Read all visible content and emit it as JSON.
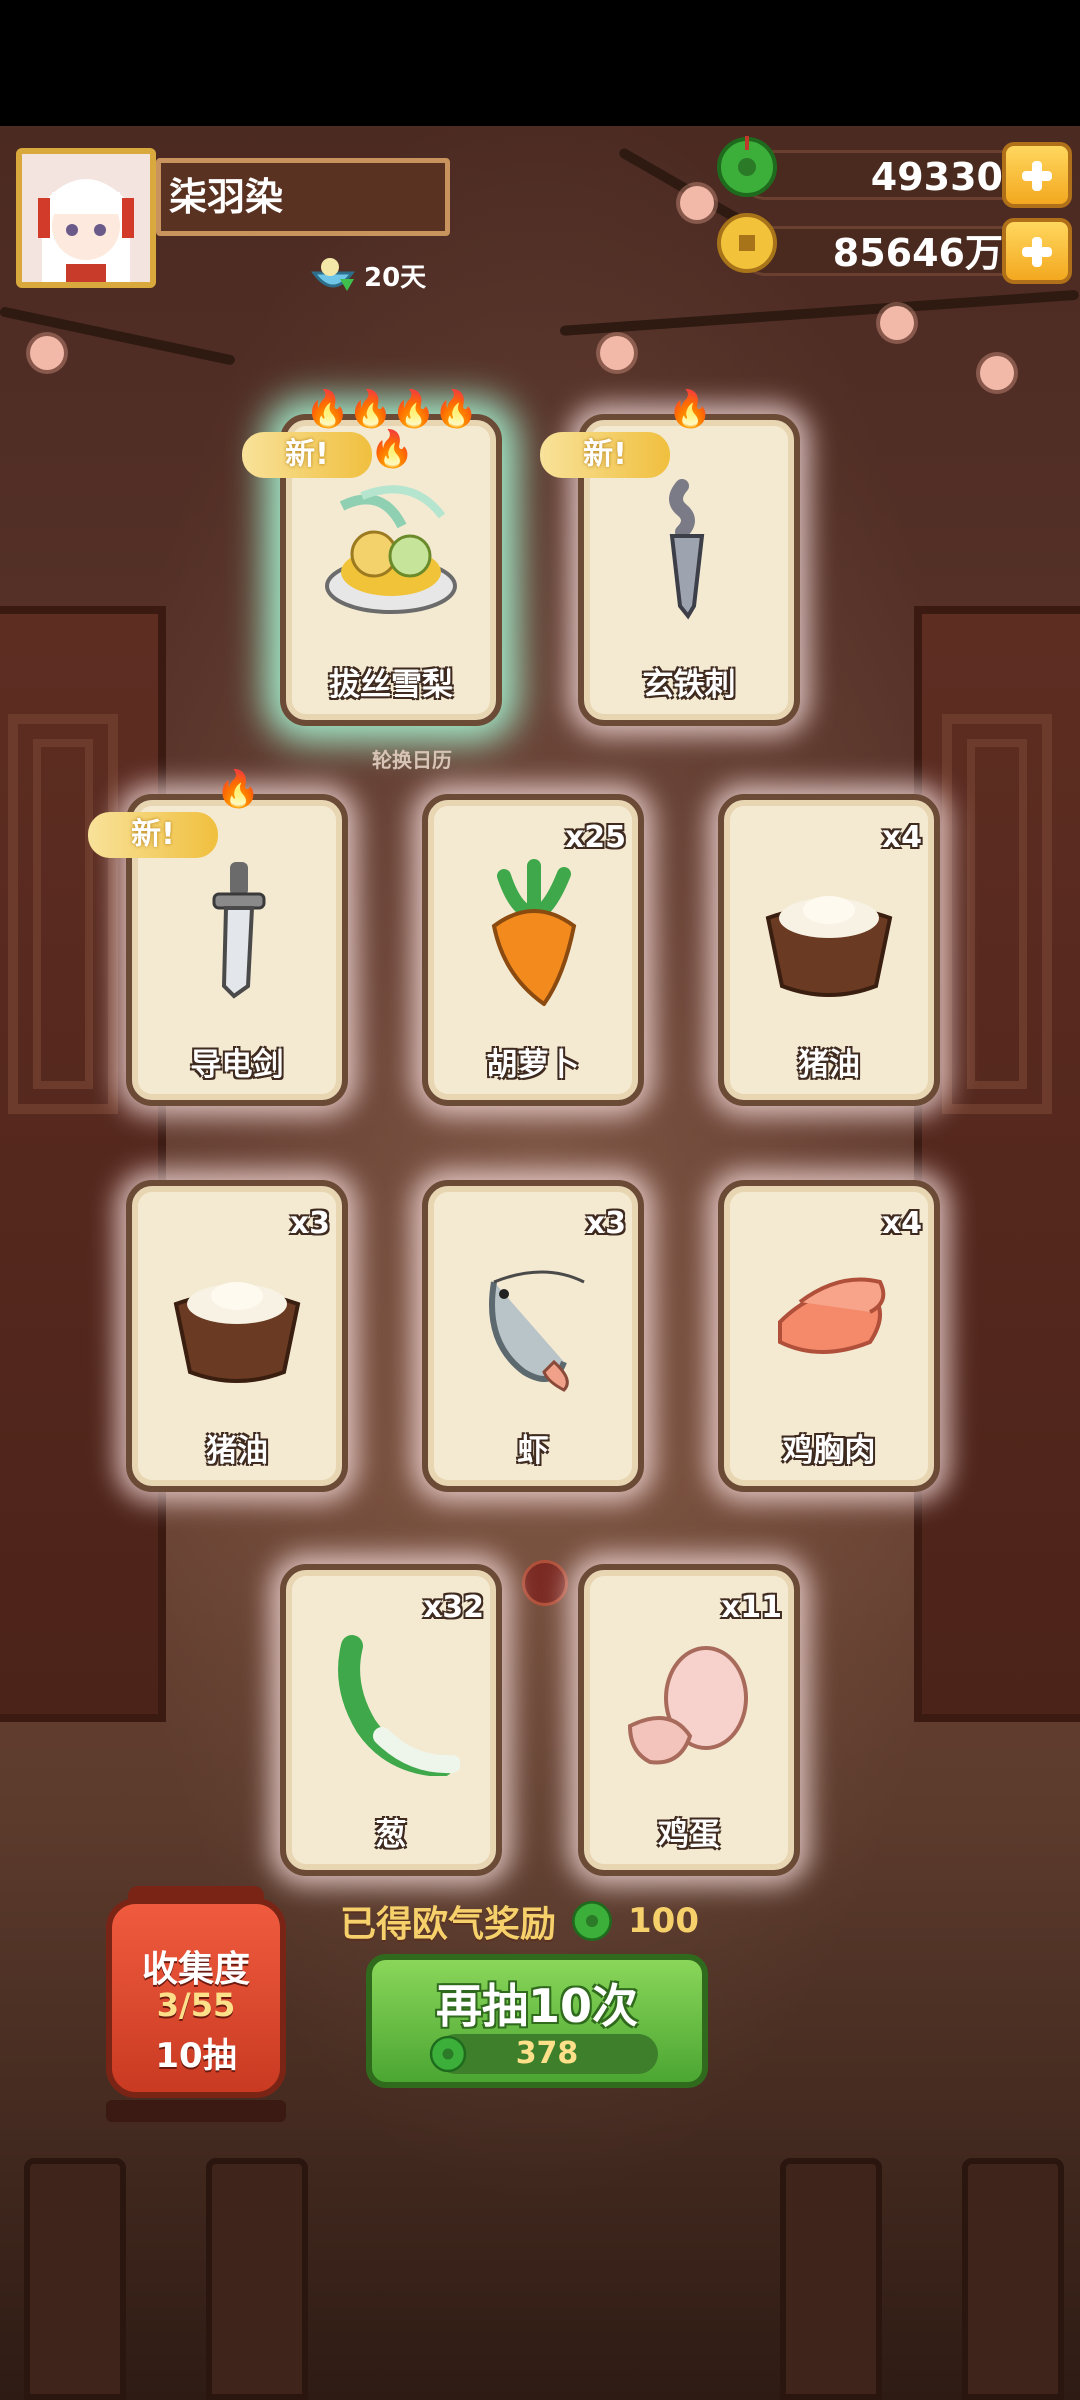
{
  "player": {
    "name": "柒羽染",
    "days": "20天"
  },
  "currency": {
    "jade": "49330",
    "coins": "85646万"
  },
  "calendar_label": "轮换日历",
  "cards": [
    {
      "name": "拔丝雪梨",
      "qty": "",
      "new": "新",
      "stars": 5,
      "rare": true,
      "icon": "pear-dish-icon"
    },
    {
      "name": "玄铁刺",
      "qty": "",
      "new": "新",
      "stars": 1,
      "rare": false,
      "icon": "iron-dagger-icon"
    },
    {
      "name": "导电剑",
      "qty": "",
      "new": "新",
      "stars": 1,
      "rare": false,
      "icon": "sword-icon"
    },
    {
      "name": "胡萝卜",
      "qty": "x25",
      "new": "",
      "stars": 0,
      "icon": "carrot-icon"
    },
    {
      "name": "猪油",
      "qty": "x4",
      "new": "",
      "stars": 0,
      "icon": "lard-bowl-icon"
    },
    {
      "name": "猪油",
      "qty": "x3",
      "new": "",
      "stars": 0,
      "icon": "lard-bowl-icon"
    },
    {
      "name": "虾",
      "qty": "x3",
      "new": "",
      "stars": 0,
      "icon": "shrimp-icon"
    },
    {
      "name": "鸡胸肉",
      "qty": "x4",
      "new": "",
      "stars": 0,
      "icon": "chicken-breast-icon"
    },
    {
      "name": "葱",
      "qty": "x32",
      "new": "",
      "stars": 0,
      "icon": "scallion-icon"
    },
    {
      "name": "鸡蛋",
      "qty": "x11",
      "new": "",
      "stars": 0,
      "icon": "egg-icon"
    }
  ],
  "collection": {
    "title": "收集度",
    "progress": "3/55",
    "pulls": "10抽"
  },
  "luck_reward": {
    "label": "已得欧气奖励",
    "value": "100"
  },
  "draw_again": {
    "label": "再抽10次",
    "cost": "378"
  },
  "colors": {
    "accent_green": "#4ba632",
    "gold": "#f3a81f",
    "card_bg": "#f4ead2",
    "card_border": "#6b4a36"
  }
}
